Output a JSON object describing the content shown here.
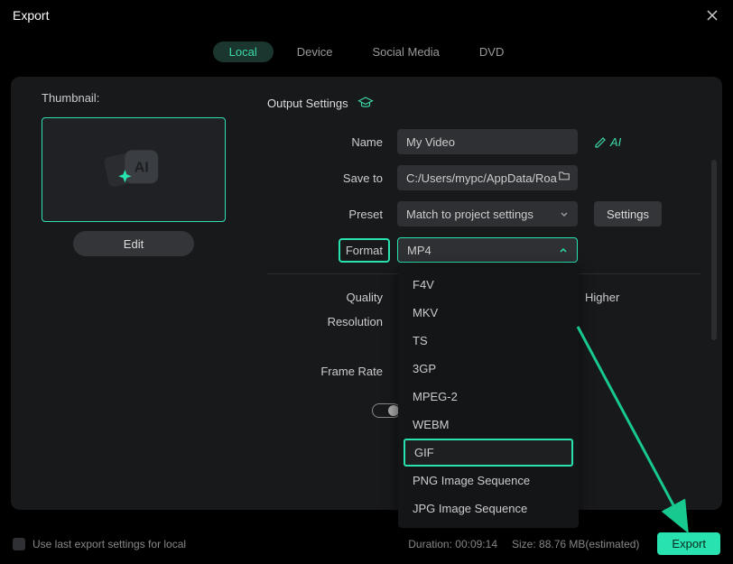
{
  "window": {
    "title": "Export"
  },
  "tabs": [
    {
      "label": "Local",
      "active": true
    },
    {
      "label": "Device"
    },
    {
      "label": "Social Media"
    },
    {
      "label": "DVD"
    }
  ],
  "thumbnail": {
    "label": "Thumbnail:",
    "edit": "Edit"
  },
  "output": {
    "header": "Output Settings",
    "fields": {
      "name_label": "Name",
      "name_value": "My Video",
      "saveto_label": "Save to",
      "saveto_value": "C:/Users/mypc/AppData/Roa",
      "preset_label": "Preset",
      "preset_value": "Match to project settings",
      "format_label": "Format",
      "format_value": "MP4",
      "quality_label": "Quality",
      "quality_higher": "Higher",
      "resolution_label": "Resolution",
      "framerate_label": "Frame Rate",
      "settings_btn": "Settings"
    },
    "format_options": [
      "F4V",
      "MKV",
      "TS",
      "3GP",
      "MPEG-2",
      "WEBM",
      "GIF",
      "PNG Image Sequence",
      "JPG Image Sequence"
    ]
  },
  "footer": {
    "use_last": "Use last export settings for local",
    "duration_label": "Duration:",
    "duration_value": "00:09:14",
    "size_label": "Size:",
    "size_value": "88.76 MB(estimated)",
    "export_btn": "Export"
  },
  "colors": {
    "accent": "#28e2af"
  }
}
